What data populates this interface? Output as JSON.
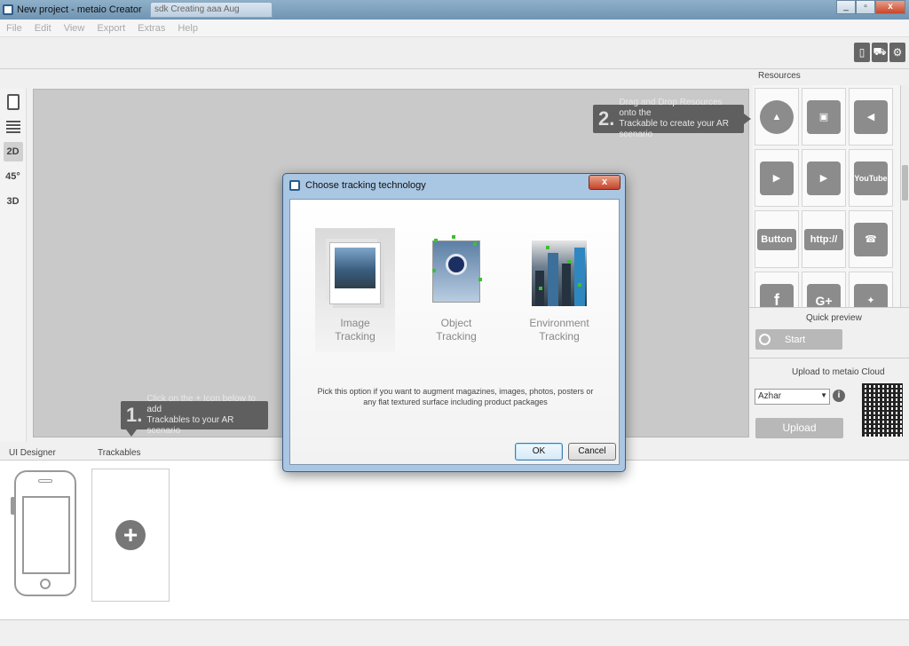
{
  "window": {
    "title": "New project - metaio Creator",
    "background_tab": "sdk Creating aaa Aug",
    "controls": [
      "_",
      "▫",
      "x"
    ]
  },
  "menu": [
    "File",
    "Edit",
    "View",
    "Export",
    "Extras",
    "Help"
  ],
  "toolbar": {
    "right_icons": [
      "phone-icon",
      "cart-icon",
      "gear-icon"
    ]
  },
  "left_tools": [
    "page-icon",
    "grid-icon",
    "2D",
    "45°",
    "3D"
  ],
  "callouts": {
    "step2": {
      "num": "2.",
      "text": "Drag and Drop Resources onto the\nTrackable to create your AR scenario"
    },
    "step1": {
      "num": "1.",
      "text": "Click on the + Icon below to add\nTrackables to your AR scenario"
    }
  },
  "resources": {
    "label": "Resources",
    "tiles": [
      {
        "icon": "3d-shapes-icon",
        "label": ""
      },
      {
        "icon": "image-icon",
        "label": ""
      },
      {
        "icon": "speaker-icon",
        "label": ""
      },
      {
        "icon": "video-icon",
        "label": ""
      },
      {
        "icon": "movie-icon",
        "label": ""
      },
      {
        "icon": "youtube-icon",
        "label": "YouTube"
      },
      {
        "icon": "button-icon",
        "label": "Button"
      },
      {
        "icon": "link-icon",
        "label": "http://"
      },
      {
        "icon": "contact-icon",
        "label": ""
      },
      {
        "icon": "facebook-icon",
        "label": "f"
      },
      {
        "icon": "googleplus-icon",
        "label": "G+"
      },
      {
        "icon": "twitter-icon",
        "label": ""
      }
    ]
  },
  "quick_preview": {
    "title": "Quick preview",
    "start": "Start"
  },
  "upload": {
    "title": "Upload to metaio Cloud",
    "select_value": "Azhar",
    "button": "Upload"
  },
  "bottom": {
    "ui_designer": "UI Designer",
    "trackables": "Trackables"
  },
  "dialog": {
    "title": "Choose tracking technology",
    "close": "x",
    "options": [
      {
        "label": "Image\nTracking",
        "selected": true
      },
      {
        "label": "Object\nTracking",
        "selected": false
      },
      {
        "label": "Environment\nTracking",
        "selected": false
      }
    ],
    "description": "Pick this option if you want to augment magazines, images, photos, posters or any flat textured surface including product packages",
    "ok": "OK",
    "cancel": "Cancel"
  }
}
